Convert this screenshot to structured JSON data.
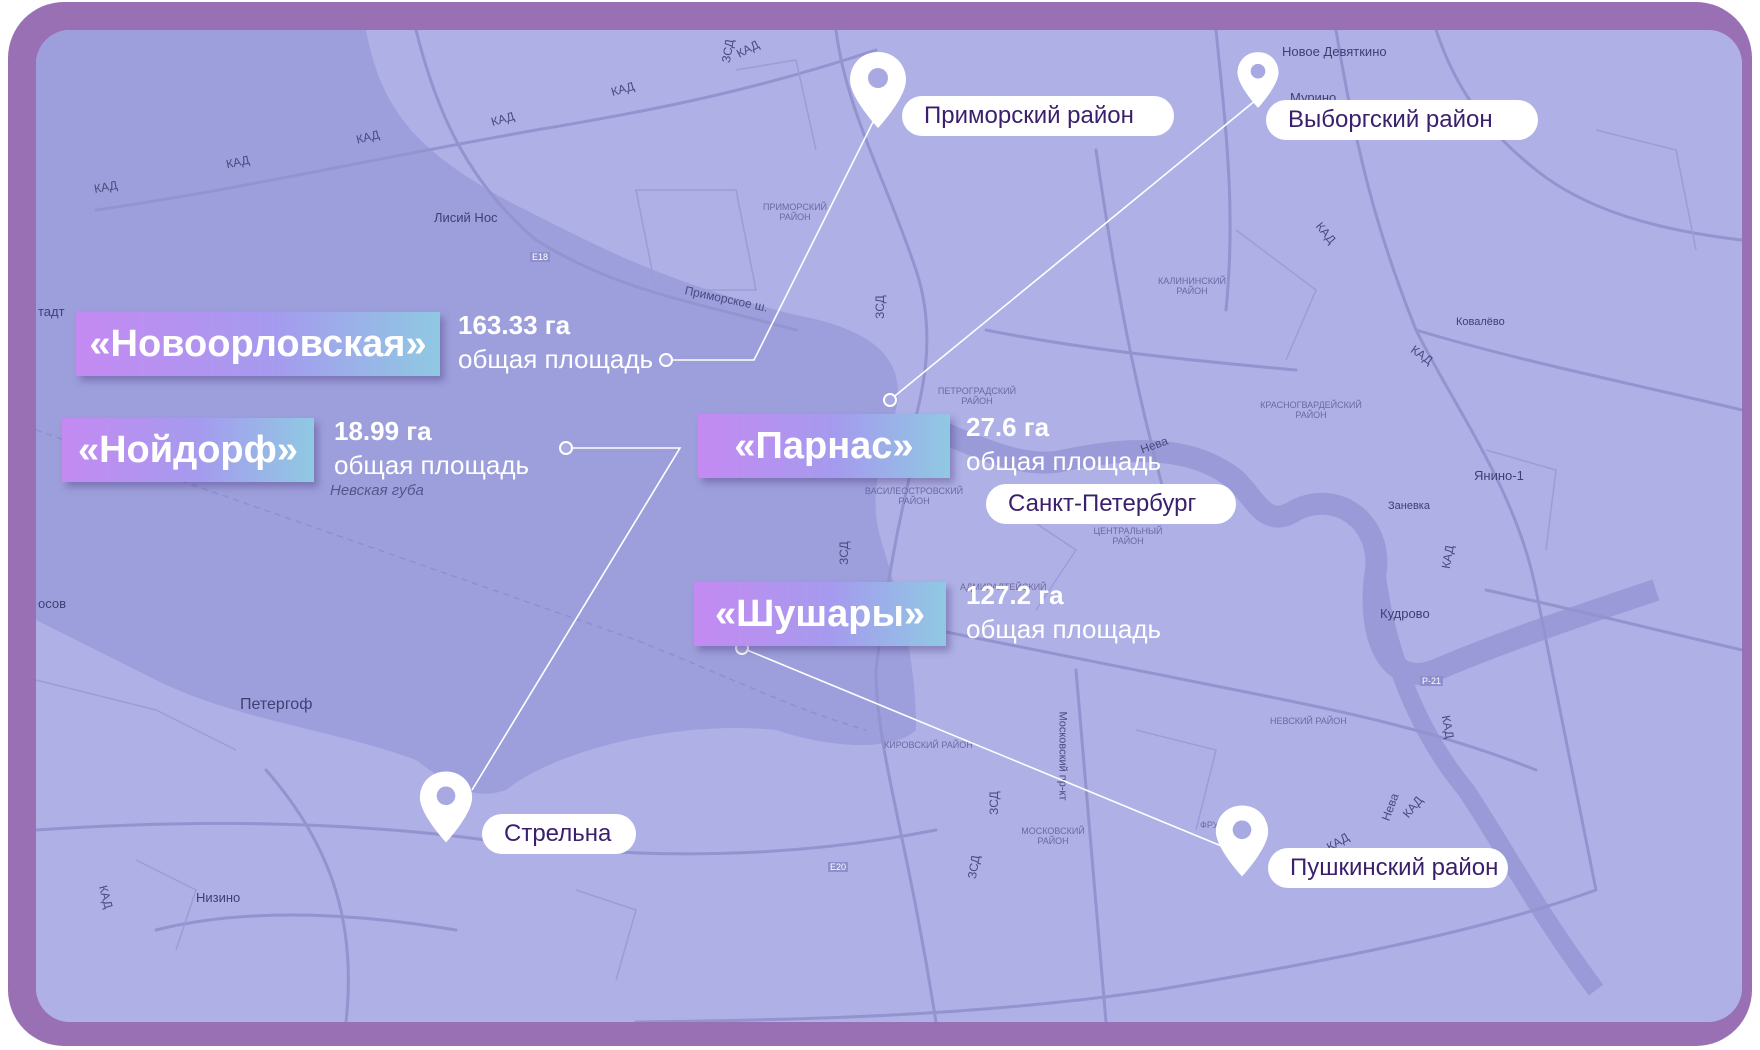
{
  "map": {
    "labels": {
      "kad": "КАД",
      "zsd": "ЗСД",
      "lisiy_nos": "Лисий Нос",
      "primorskoe_sh": "Приморское ш.",
      "nevskaya_guba": "Невская губа",
      "petergof": "Петергоф",
      "nizino": "Низино",
      "novoe_devyatkino": "Новое Девяткино",
      "murino": "Мурино",
      "kovalevo": "Ковалёво",
      "yanino": "Янино-1",
      "zanevka": "Заневка",
      "kudrovo": "Кудрово",
      "moskovsky_pr": "Московский пр-кт",
      "e18": "E18",
      "e20": "E20",
      "r21": "Р-21",
      "neva": "Нева",
      "tadt": "тадт",
      "osov": "осов",
      "primorsky_small": "ПРИМОРСКИЙ РАЙОН",
      "kalininsky_small": "КАЛИНИНСКИЙ РАЙОН",
      "petrogradsky_small": "ПЕТРОГРАДСКИЙ РАЙОН",
      "krasnogvardeysky_small": "КРАСНОГВАРДЕЙСКИЙ РАЙОН",
      "vasileostrovsky_small": "ВАСИЛЕОСТРОВСКИЙ РАЙОН",
      "centralny_small": "ЦЕНТРАЛЬНЫЙ РАЙОН",
      "admiralteysky_small": "АДМИРАЛТЕЙСКИЙ",
      "nevsky_small": "НЕВСКИЙ РАЙОН",
      "kirovsky_small": "КИРОВСКИЙ РАЙОН",
      "moskovsky_small": "МОСКОВСКИЙ РАЙОН",
      "frunzensky_small": "ФРУНЗЕНСКИЙ"
    }
  },
  "districts": {
    "primorsky": "Приморский район",
    "vyborgsky": "Выборгский район",
    "spb": "Санкт-Петербург",
    "strelna": "Стрельна",
    "pushkinsky": "Пушкинский район"
  },
  "projects": [
    {
      "name": "«Новоорловская»",
      "area": "163.33 га",
      "caption": "общая площадь"
    },
    {
      "name": "«Нойдорф»",
      "area": "18.99 га",
      "caption": "общая площадь"
    },
    {
      "name": "«Парнас»",
      "area": "27.6 га",
      "caption": "общая площадь"
    },
    {
      "name": "«Шушары»",
      "area": "127.2 га",
      "caption": "общая площадь"
    }
  ],
  "colors": {
    "frame": "#9a70b4",
    "map_base": "#a8a9e2",
    "water": "#9d9fdc",
    "pin": "#ffffff",
    "pill_text": "#3a1f6c",
    "tag_gradient": [
      "#c48af2",
      "#a59bee",
      "#8fc9e2"
    ]
  },
  "icons": {
    "pin": "location-pin-icon"
  }
}
